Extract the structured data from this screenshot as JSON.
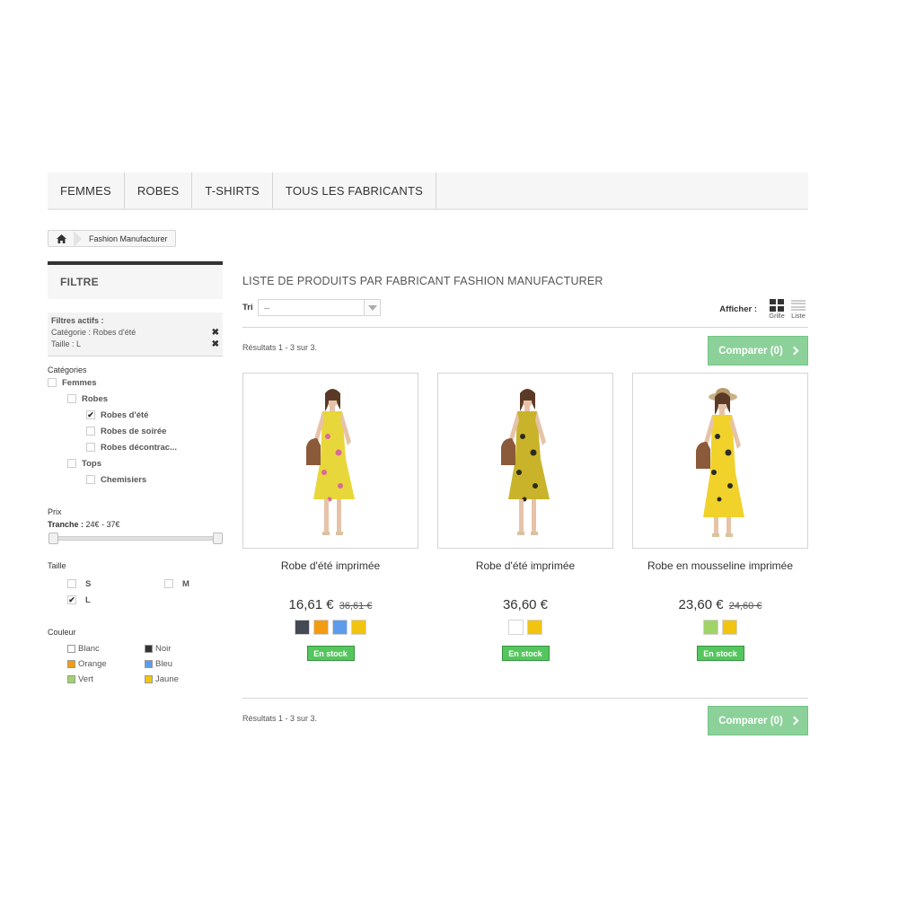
{
  "menu": [
    "FEMMES",
    "ROBES",
    "T-SHIRTS",
    "TOUS LES FABRICANTS"
  ],
  "breadcrumb": {
    "label": "Fashion Manufacturer"
  },
  "sidebar": {
    "filter_title": "FILTRE",
    "active_filters": {
      "title": "Filtres actifs :",
      "items": [
        "Catégorie : Robes d'été",
        "Taille : L"
      ]
    },
    "categories_title": "Catégories",
    "categories": [
      {
        "label": "Femmes",
        "checked": false,
        "level": 0
      },
      {
        "label": "Robes",
        "checked": false,
        "level": 1
      },
      {
        "label": "Robes d'été",
        "checked": true,
        "level": 2
      },
      {
        "label": "Robes de soirée",
        "checked": false,
        "level": 2
      },
      {
        "label": "Robes décontrac...",
        "checked": false,
        "level": 2
      },
      {
        "label": "Tops",
        "checked": false,
        "level": 1
      },
      {
        "label": "Chemisiers",
        "checked": false,
        "level": 2
      }
    ],
    "price_title": "Prix",
    "price_range_label": "Tranche :",
    "price_range_value": "24€ - 37€",
    "size_title": "Taille",
    "sizes": [
      {
        "label": "S",
        "checked": false
      },
      {
        "label": "M",
        "checked": false
      },
      {
        "label": "L",
        "checked": true
      }
    ],
    "color_title": "Couleur",
    "colors": [
      {
        "label": "Blanc",
        "hex": "#ffffff"
      },
      {
        "label": "Noir",
        "hex": "#333333"
      },
      {
        "label": "Orange",
        "hex": "#f39c11"
      },
      {
        "label": "Bleu",
        "hex": "#5d9cec"
      },
      {
        "label": "Vert",
        "hex": "#a0d468"
      },
      {
        "label": "Jaune",
        "hex": "#f1c40f"
      }
    ]
  },
  "main": {
    "title": "LISTE DE PRODUITS PAR FABRICANT FASHION MANUFACTURER",
    "sort_label": "Tri",
    "sort_value": "--",
    "display_label": "Afficher :",
    "view_grid": "Grille",
    "view_list": "Liste",
    "results_text": "Résultats 1 - 3 sur 3.",
    "compare_label": "Comparer (0)"
  },
  "products": [
    {
      "name": "Robe d'été imprimée",
      "price": "16,61 €",
      "old_price": "36,61 €",
      "colors": [
        "#434a54",
        "#f39c11",
        "#5d9cec",
        "#f1c40f"
      ],
      "stock": "En stock"
    },
    {
      "name": "Robe d'été imprimée",
      "price": "36,60 €",
      "old_price": "",
      "colors": [
        "#ffffff",
        "#f1c40f"
      ],
      "stock": "En stock"
    },
    {
      "name": "Robe en mousseline imprimée",
      "price": "23,60 €",
      "old_price": "24,60 €",
      "colors": [
        "#a0d468",
        "#f1c40f"
      ],
      "stock": "En stock"
    }
  ]
}
